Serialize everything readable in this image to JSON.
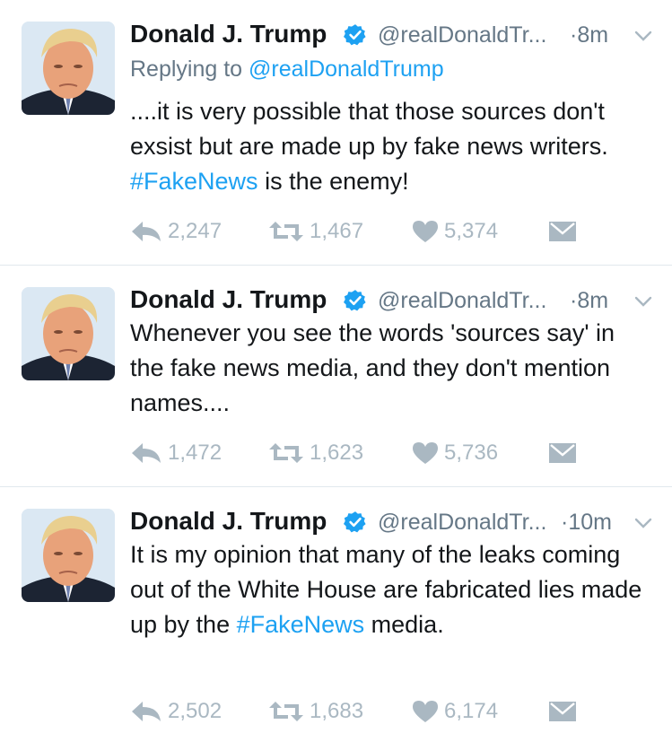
{
  "colors": {
    "link": "#1da1f2",
    "muted": "#657786",
    "action": "#aab8c2",
    "divider": "#e1e8ed"
  },
  "icons": [
    "verified-badge-icon",
    "chevron-down-icon",
    "reply-icon",
    "retweet-icon",
    "like-heart-icon",
    "direct-message-icon"
  ],
  "tweets": [
    {
      "name": "Donald J. Trump",
      "handle": "@realDonaldTr...",
      "time": "·8m",
      "reply_prefix": "Replying to ",
      "reply_handle": "@realDonaldTrump",
      "text_parts": [
        "....it is very possible that those sources don't exsist but are made up by fake news writers. ",
        "#FakeNews",
        " is the enemy!"
      ],
      "replies": "2,247",
      "retweets": "1,467",
      "likes": "5,374"
    },
    {
      "name": "Donald J. Trump",
      "handle": "@realDonaldTr...",
      "time": "·8m",
      "text": "Whenever you see the words 'sources say' in the fake news media, and they don't mention names....",
      "replies": "1,472",
      "retweets": "1,623",
      "likes": "5,736"
    },
    {
      "name": "Donald J. Trump",
      "handle": "@realDonaldTr...",
      "time": "·10m",
      "text_parts": [
        "It is my opinion that many of the leaks coming out of the White House are fabricated lies made up by the ",
        "#FakeNews",
        " media."
      ],
      "replies": "2,502",
      "retweets": "1,683",
      "likes": "6,174"
    }
  ]
}
